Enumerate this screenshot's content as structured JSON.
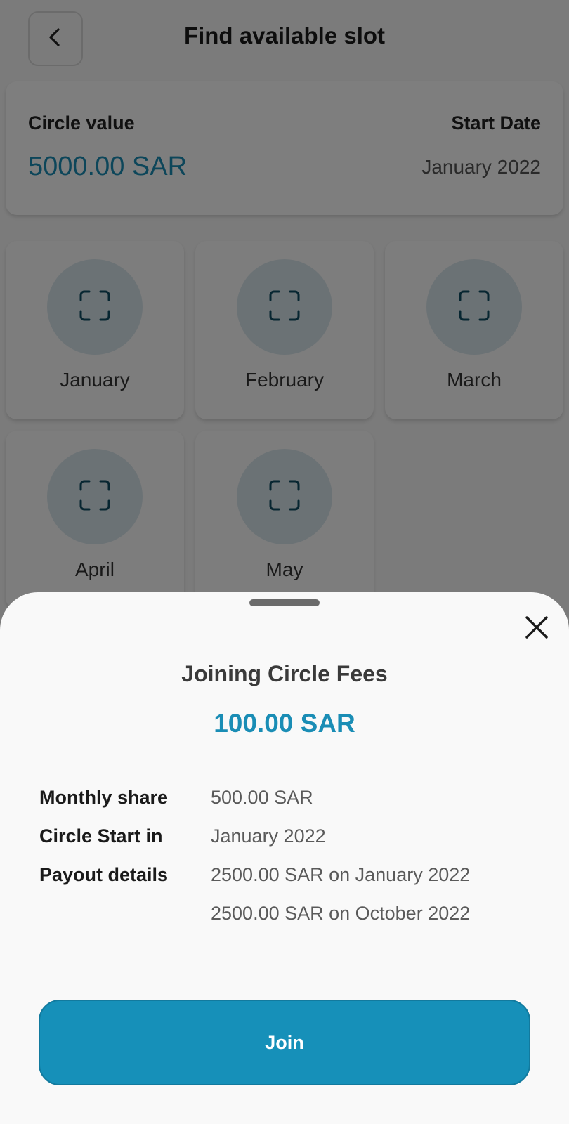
{
  "header": {
    "title": "Find available slot",
    "back_icon": "chevron-left-icon"
  },
  "summary": {
    "circle_value_label": "Circle value",
    "circle_value": "5000.00 SAR",
    "start_date_label": "Start Date",
    "start_date": "January 2022"
  },
  "slots": [
    {
      "month": "January",
      "icon": "scan-frame-icon"
    },
    {
      "month": "February",
      "icon": "scan-frame-icon"
    },
    {
      "month": "March",
      "icon": "scan-frame-icon"
    },
    {
      "month": "April",
      "icon": "scan-frame-icon"
    },
    {
      "month": "May",
      "icon": "scan-frame-icon"
    }
  ],
  "sheet": {
    "title": "Joining Circle Fees",
    "fee": "100.00 SAR",
    "close_icon": "close-icon",
    "details": [
      {
        "label": "Monthly share",
        "value": "500.00 SAR"
      },
      {
        "label": "Circle Start in",
        "value": "January 2022"
      },
      {
        "label": "Payout details",
        "value": "2500.00 SAR on January 2022"
      },
      {
        "label": "",
        "value": "2500.00 SAR on October 2022"
      }
    ],
    "join_label": "Join"
  },
  "colors": {
    "accent": "#1a8db5",
    "button": "#1690b9",
    "overlay": "rgba(0,0,0,0.5)"
  }
}
